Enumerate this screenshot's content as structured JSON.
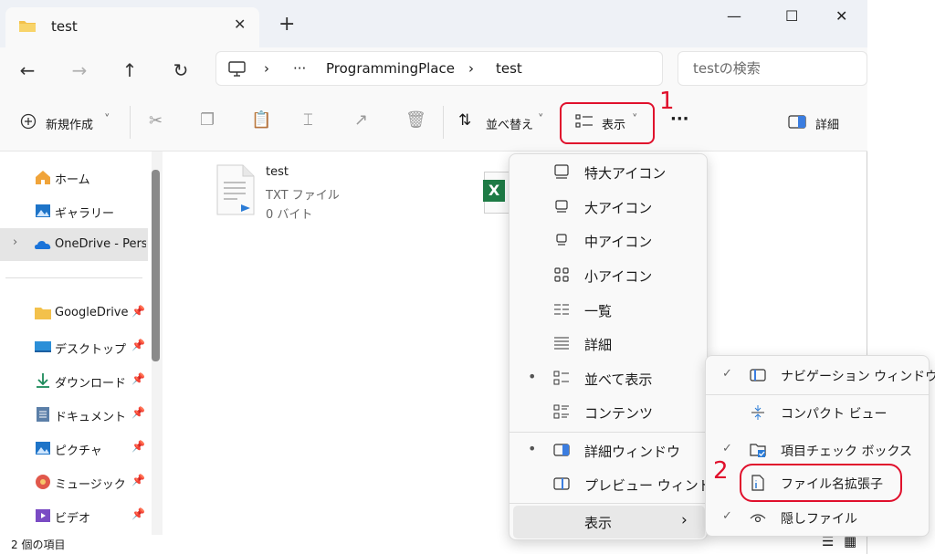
{
  "tab": {
    "title": "test",
    "close": "✕",
    "add": "+"
  },
  "window": {
    "min": "—",
    "max": "☐",
    "close": "✕"
  },
  "nav": {
    "back": "←",
    "forward": "→",
    "up": "↑",
    "refresh": "↻"
  },
  "address": {
    "sep": "›",
    "more": "···",
    "crumbs": [
      "ProgrammingPlace",
      "test"
    ]
  },
  "search": {
    "placeholder": "testの検索"
  },
  "toolbar": {
    "new": "新規作成",
    "sort": "並べ替え",
    "view": "表示",
    "more": "···",
    "details": "詳細",
    "caret": "˅"
  },
  "annotations": {
    "one": "1",
    "two": "2"
  },
  "sidebar": {
    "items": [
      {
        "label": "ホーム"
      },
      {
        "label": "ギャラリー"
      },
      {
        "label": "OneDrive - Perso"
      },
      {
        "label": "GoogleDrive"
      },
      {
        "label": "デスクトップ"
      },
      {
        "label": "ダウンロード"
      },
      {
        "label": "ドキュメント"
      },
      {
        "label": "ピクチャ"
      },
      {
        "label": "ミュージック"
      },
      {
        "label": "ビデオ"
      }
    ],
    "expand": "›"
  },
  "files": [
    {
      "name": "test",
      "type": "TXT ファイル",
      "size": "0 バイト"
    }
  ],
  "excel_letter": "X",
  "status": {
    "count": "2 個の項目"
  },
  "view_menu": {
    "items": [
      {
        "label": "特大アイコン",
        "selected": false
      },
      {
        "label": "大アイコン",
        "selected": false
      },
      {
        "label": "中アイコン",
        "selected": false
      },
      {
        "label": "小アイコン",
        "selected": false
      },
      {
        "label": "一覧",
        "selected": false
      },
      {
        "label": "詳細",
        "selected": false
      },
      {
        "label": "並べて表示",
        "selected": true
      },
      {
        "label": "コンテンツ",
        "selected": false
      },
      {
        "label": "詳細ウィンドウ",
        "selected": true
      },
      {
        "label": "プレビュー ウィンドウ",
        "selected": false
      },
      {
        "label": "表示",
        "selected": false
      }
    ],
    "bullet": "•",
    "arrow": "›"
  },
  "show_submenu": {
    "items": [
      {
        "label": "ナビゲーション ウィンドウ",
        "checked": true
      },
      {
        "label": "コンパクト ビュー",
        "checked": false
      },
      {
        "label": "項目チェック ボックス",
        "checked": true
      },
      {
        "label": "ファイル名拡張子",
        "checked": false
      },
      {
        "label": "隠しファイル",
        "checked": true
      }
    ],
    "check": "✓"
  }
}
